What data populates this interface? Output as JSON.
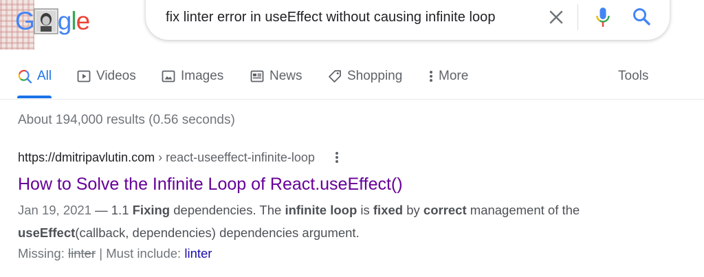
{
  "logo": {
    "letter_1": "G",
    "letters_end_g": "g",
    "letters_end_l": "l",
    "letters_end_e": "e"
  },
  "search": {
    "query": "fix linter error in useEffect without causing infinite loop"
  },
  "tabs": [
    {
      "label": "All",
      "icon": "search-icon",
      "active": true
    },
    {
      "label": "Videos",
      "icon": "video-icon"
    },
    {
      "label": "Images",
      "icon": "image-icon"
    },
    {
      "label": "News",
      "icon": "news-icon"
    },
    {
      "label": "Shopping",
      "icon": "tag-icon"
    },
    {
      "label": "More",
      "icon": "more-vertical-icon"
    },
    {
      "label": "Tools"
    }
  ],
  "stats": "About 194,000 results (0.56 seconds)",
  "result": {
    "site": "https://dmitripavlutin.com",
    "path": " › react-useeffect-infinite-loop",
    "title": "How to Solve the Infinite Loop of React.useEffect()",
    "snippet": {
      "date": "Jan 19, 2021",
      "dash": " — ",
      "t1": "1.1 ",
      "b1": "Fixing",
      "t2": " dependencies. The ",
      "b2": "infinite loop",
      "t3": " is ",
      "b3": "fixed",
      "t4": " by ",
      "b4": "correct",
      "t5": " management of the ",
      "b5": "useEffect",
      "t6": "(callback, dependencies) dependencies argument."
    },
    "missing_label": "Missing: ",
    "missing_term": "linter",
    "must_include_label": " | Must include: ",
    "must_include_term": "linter"
  },
  "colors": {
    "accent": "#1a73e8",
    "visited_link": "#660099",
    "link": "#1a0dab"
  }
}
